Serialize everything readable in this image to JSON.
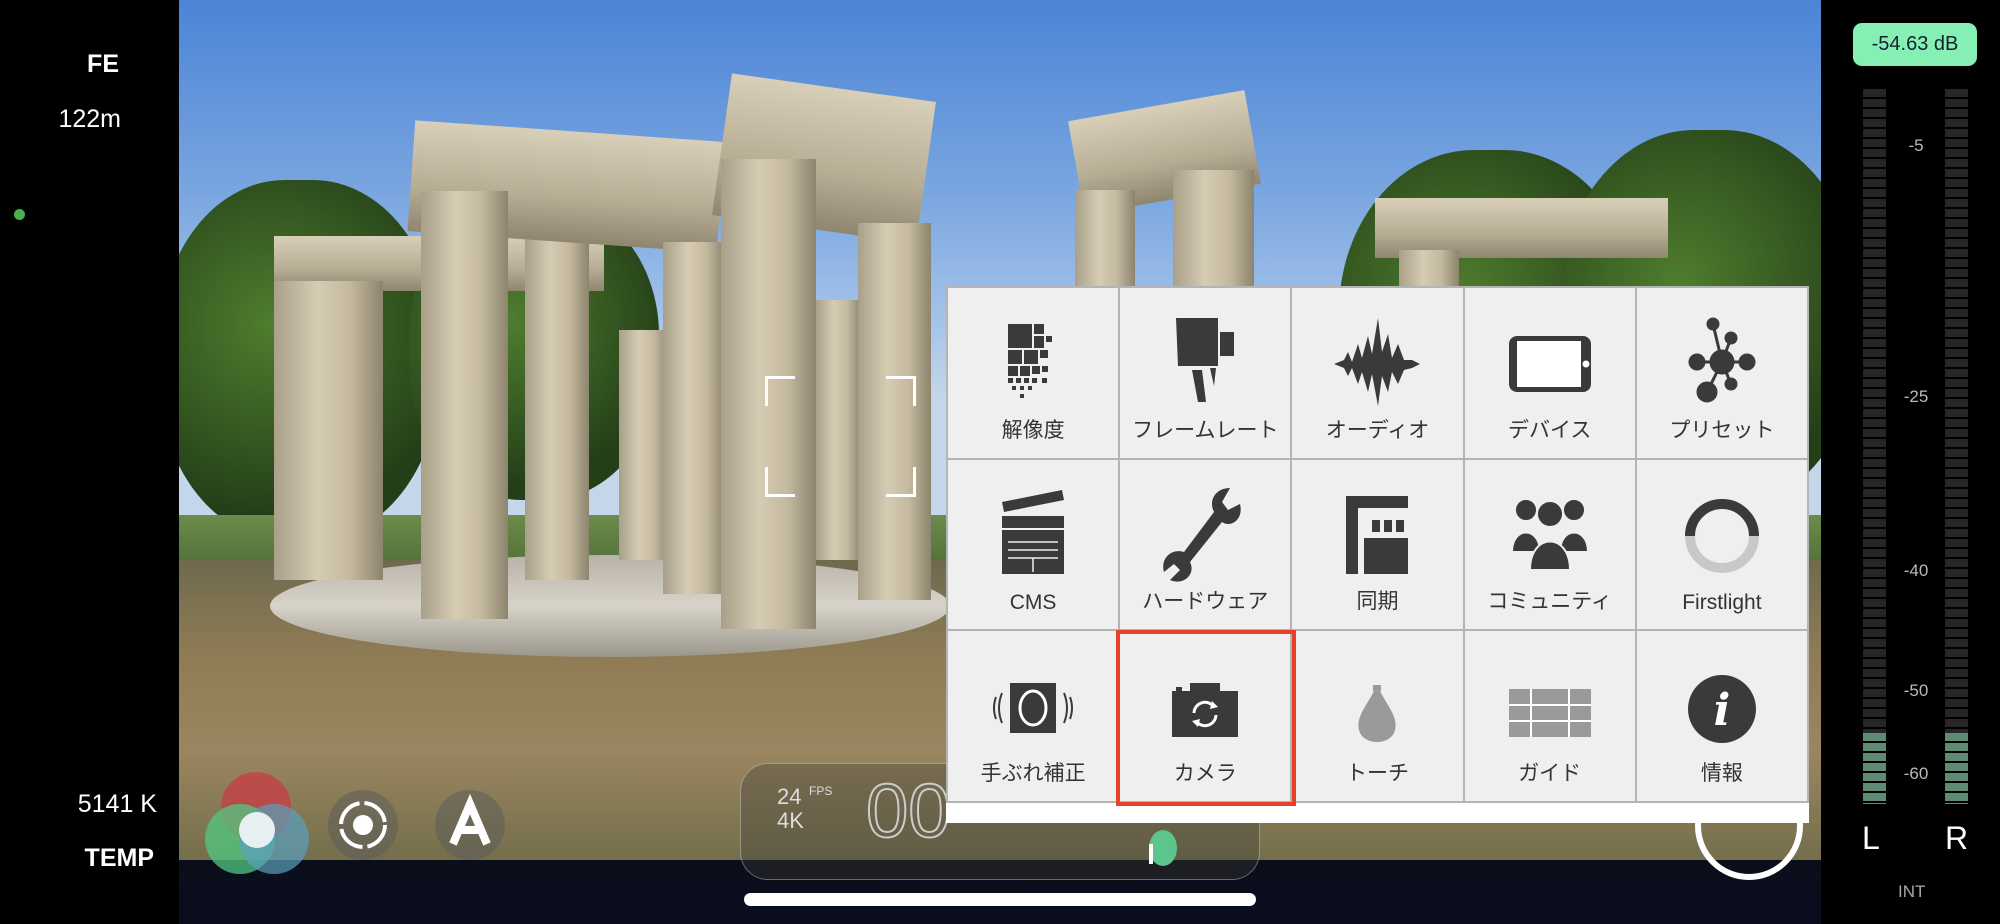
{
  "left_panel": {
    "lens": "FE",
    "distance": "122m",
    "white_balance": "5141 K",
    "wb_mode": "TEMP",
    "status_dot_color": "#4caf50"
  },
  "record_panel": {
    "fps": "24",
    "fps_unit": "FPS",
    "resolution": "4K",
    "timecode": "00"
  },
  "menu": {
    "items": [
      {
        "label": "解像度",
        "icon": "resolution-icon"
      },
      {
        "label": "フレームレート",
        "icon": "movie-camera-icon"
      },
      {
        "label": "オーディオ",
        "icon": "waveform-icon"
      },
      {
        "label": "デバイス",
        "icon": "device-icon"
      },
      {
        "label": "プリセット",
        "icon": "preset-network-icon"
      },
      {
        "label": "CMS",
        "icon": "clapperboard-icon"
      },
      {
        "label": "ハードウェア",
        "icon": "wrench-icon"
      },
      {
        "label": "同期",
        "icon": "sync-icon"
      },
      {
        "label": "コミュニティ",
        "icon": "community-icon"
      },
      {
        "label": "Firstlight",
        "icon": "firstlight-ring-icon"
      },
      {
        "label": "手ぶれ補正",
        "icon": "stabilization-icon"
      },
      {
        "label": "カメラ",
        "icon": "camera-switch-icon"
      },
      {
        "label": "トーチ",
        "icon": "torch-icon"
      },
      {
        "label": "ガイド",
        "icon": "guide-grid-icon"
      },
      {
        "label": "情報",
        "icon": "info-icon"
      }
    ],
    "selected": "カメラ",
    "highlight_color": "#e8402a"
  },
  "audio": {
    "level_db": "-54.63 dB",
    "ticks": [
      "-5",
      "-25",
      "-40",
      "-50",
      "-60"
    ],
    "left_label": "L",
    "right_label": "R",
    "source": "INT",
    "left_level_fraction": 0.1,
    "right_level_fraction": 0.1,
    "meter_color": "#86f0b4"
  }
}
